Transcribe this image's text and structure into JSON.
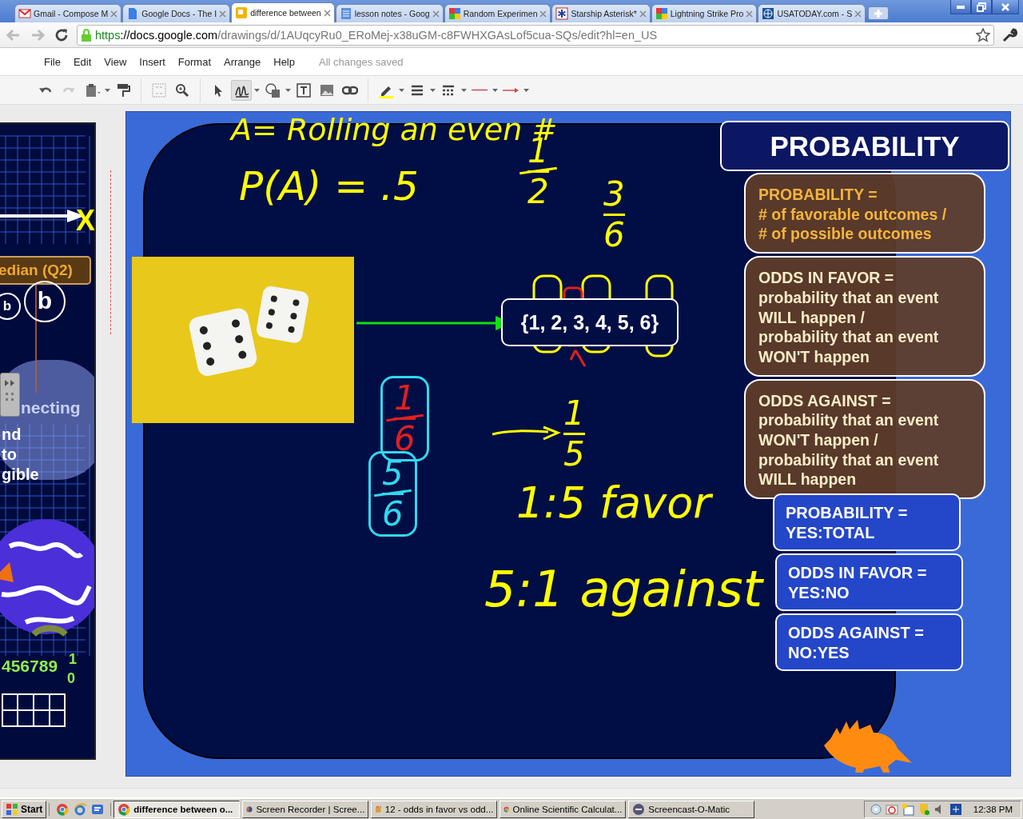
{
  "browser": {
    "tabs": [
      {
        "title": "Gmail - Compose M",
        "selected": false
      },
      {
        "title": "Google Docs - The I",
        "selected": false
      },
      {
        "title": "difference between",
        "selected": true
      },
      {
        "title": "lesson notes - Goog",
        "selected": false
      },
      {
        "title": "Random Experimen",
        "selected": false
      },
      {
        "title": "Starship Asterisk*",
        "selected": false
      },
      {
        "title": "Lightning Strike Pro",
        "selected": false
      },
      {
        "title": "USATODAY.com - S",
        "selected": false
      }
    ],
    "url": {
      "scheme": "https",
      "host": "://docs.google.com",
      "path": "/drawings/d/1AUqcyRu0_ERoMej-x38uGM-c8FWHXGAsLof5cua-SQs/edit?hl=en_US"
    }
  },
  "menu": [
    "File",
    "Edit",
    "View",
    "Insert",
    "Format",
    "Arrange",
    "Help"
  ],
  "save_status": "All changes saved",
  "toolbar": [
    {
      "kind": "undo",
      "selected": false
    },
    {
      "kind": "redo",
      "selected": false
    },
    {
      "kind": "paste",
      "selected": false
    },
    {
      "kind": "paint",
      "selected": false
    },
    {
      "kind": "fit",
      "selected": false
    },
    {
      "kind": "zoom",
      "selected": false
    },
    {
      "kind": "pointer",
      "selected": false
    },
    {
      "kind": "scribble",
      "selected": true
    },
    {
      "kind": "shape",
      "selected": false
    },
    {
      "kind": "textbox",
      "selected": false
    },
    {
      "kind": "image",
      "selected": false
    },
    {
      "kind": "link",
      "selected": false
    },
    {
      "kind": "pen",
      "selected": false
    },
    {
      "kind": "weight",
      "selected": false
    },
    {
      "kind": "dash",
      "selected": false
    },
    {
      "kind": "start",
      "selected": false
    },
    {
      "kind": "end",
      "selected": false
    }
  ],
  "left_slide": {
    "texts": [
      {
        "kind": "axis",
        "text": "X"
      },
      {
        "kind": "tag",
        "text": "edian (Q2)"
      },
      {
        "kind": "bubble",
        "text": "b"
      },
      {
        "kind": "bigbubble",
        "text": "b"
      },
      {
        "kind": "cloud",
        "text": "necting"
      },
      {
        "kind": "line1",
        "text": "nd"
      },
      {
        "kind": "line2",
        "text": "to"
      },
      {
        "kind": "line3",
        "text": "gible"
      },
      {
        "kind": "digits",
        "text": "456789"
      },
      {
        "kind": "ten1",
        "text": "1"
      },
      {
        "kind": "ten0",
        "text": "0"
      }
    ]
  },
  "slide": {
    "ink": [
      {
        "kind": "note",
        "text": "A= Rolling an even #"
      },
      {
        "kind": "note",
        "text": "P(A) = .5"
      },
      {
        "kind": "fraction",
        "numerator": "1",
        "denominator": "2",
        "color": "#ffff00",
        "struck": true,
        "boxed": false
      },
      {
        "kind": "fraction",
        "numerator": "3",
        "denominator": "6",
        "color": "#ffff00",
        "struck": false,
        "boxed": false
      },
      {
        "kind": "fraction",
        "numerator": "1",
        "denominator": "6",
        "color": "#e02020",
        "struck": true,
        "boxed": true
      },
      {
        "kind": "fraction",
        "numerator": "5",
        "denominator": "6",
        "color": "#30d8f0",
        "struck": true,
        "boxed": true
      },
      {
        "kind": "fraction",
        "numerator": "1",
        "denominator": "5",
        "color": "#ffff00",
        "struck": false,
        "boxed": false
      },
      {
        "kind": "note",
        "text": "1:5 favor"
      },
      {
        "kind": "note",
        "text": "5:1 against"
      }
    ],
    "sample_space": "{1, 2, 3, 4, 5, 6}",
    "title": "PROBABILITY",
    "definitions": [
      {
        "lines": [
          "PROBABILITY  =",
          "# of favorable outcomes /",
          "# of possible outcomes"
        ]
      },
      {
        "lines": [
          "ODDS IN FAVOR =",
          "probability that an event",
          "WILL happen /",
          "probability that an event",
          "WON'T happen"
        ]
      },
      {
        "lines": [
          "ODDS AGAINST =",
          "probability that an event",
          "WON'T happen /",
          "probability that an event",
          "WILL happen"
        ]
      }
    ],
    "shortcuts": [
      {
        "lines": [
          "PROBABILITY =",
          "YES:TOTAL"
        ]
      },
      {
        "lines": [
          "ODDS IN FAVOR =",
          "YES:NO"
        ]
      },
      {
        "lines": [
          "ODDS AGAINST =",
          "NO:YES"
        ]
      }
    ]
  },
  "taskbar": {
    "start": "Start",
    "tasks": [
      {
        "title": "difference between o...",
        "selected": true
      },
      {
        "title": "Screen Recorder | Scree...",
        "selected": false
      },
      {
        "title": "12 - odds in favor vs odd...",
        "selected": false
      },
      {
        "title": "Online Scientific Calculat...",
        "selected": false
      },
      {
        "title": "Screencast-O-Matic",
        "selected": false
      }
    ],
    "clock": "12:38 PM"
  }
}
